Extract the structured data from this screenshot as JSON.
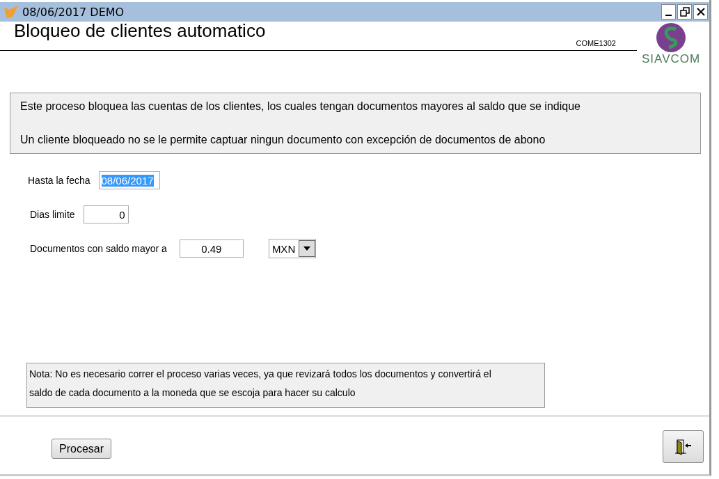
{
  "window": {
    "title": "08/06/2017  DEMO"
  },
  "header": {
    "title": "Bloqueo de clientes automatico",
    "code": "COME1302",
    "logo_text": "SIAVCOM"
  },
  "info": [
    "Este proceso bloquea las cuentas de los clientes, los cuales tengan documentos  mayores al saldo  que se indique",
    "Un cliente bloqueado no se le permite captuar ningun documento con  excepción de documentos de abono"
  ],
  "fields": [
    {
      "kind": "date",
      "label": "Hasta la fecha",
      "value": "08/06/2017",
      "text_selected": true
    },
    {
      "kind": "number",
      "label": "Dias limite",
      "value": "0",
      "text_selected": false
    },
    {
      "kind": "amount",
      "label": "Documentos con saldo mayor a",
      "value": "0.49",
      "text_selected": false,
      "currency": "MXN"
    }
  ],
  "note": "Nota:   No es necesario correr el proceso varias veces, ya que revizará todos los documentos y convertirá el saldo de cada documento a la moneda que se escoja para hacer su calculo",
  "buttons": {
    "process": "Procesar"
  }
}
